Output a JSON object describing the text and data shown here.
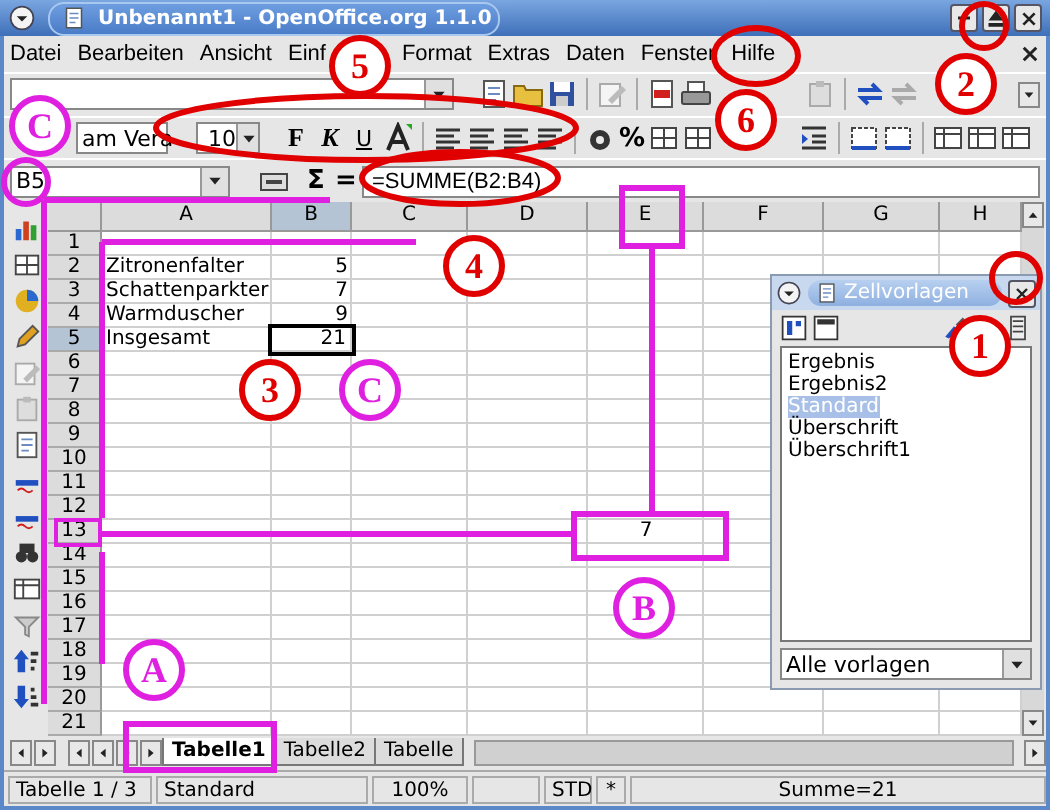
{
  "window": {
    "title": "Unbenannt1 - OpenOffice.org 1.1.0"
  },
  "menu": [
    "Datei",
    "Bearbeiten",
    "Ansicht",
    "Einf",
    "Format",
    "Extras",
    "Daten",
    "Fenster",
    "Hilfe"
  ],
  "format_toolbar": {
    "font_name": "am Vera",
    "font_size": "10",
    "style_buttons": [
      "F",
      "K",
      "U"
    ],
    "percent": "%"
  },
  "formula_bar": {
    "cell_ref": "B5",
    "sum_symbol": "Σ",
    "equals_symbol": "=",
    "formula": "=SUMME(B2:B4)"
  },
  "sheet": {
    "columns": [
      {
        "label": "A",
        "selected": false
      },
      {
        "label": "B",
        "selected": true
      },
      {
        "label": "C",
        "selected": false
      },
      {
        "label": "D",
        "selected": false
      },
      {
        "label": "E",
        "selected": false
      },
      {
        "label": "F",
        "selected": false
      },
      {
        "label": "G",
        "selected": false
      },
      {
        "label": "H",
        "selected": false
      }
    ],
    "rows": [
      {
        "label": "1",
        "selected": false
      },
      {
        "label": "2",
        "selected": false,
        "cells": [
          {
            "kind": "text",
            "value": "Zitronenfalter",
            "selected": false
          },
          {
            "kind": "number",
            "value": "5",
            "selected": false
          }
        ]
      },
      {
        "label": "3",
        "selected": false,
        "cells": [
          {
            "kind": "text",
            "value": "Schattenparkter",
            "selected": false
          },
          {
            "kind": "number",
            "value": "7",
            "selected": false
          }
        ]
      },
      {
        "label": "4",
        "selected": false,
        "cells": [
          {
            "kind": "text",
            "value": "Warmduscher",
            "selected": false
          },
          {
            "kind": "number",
            "value": "9",
            "selected": false
          }
        ]
      },
      {
        "label": "5",
        "selected": true,
        "cells": [
          {
            "kind": "text",
            "value": "Insgesamt",
            "selected": false
          },
          {
            "kind": "number",
            "value": "21",
            "selected": true
          }
        ]
      },
      {
        "label": "6",
        "selected": false
      },
      {
        "label": "7",
        "selected": false
      },
      {
        "label": "8",
        "selected": false
      },
      {
        "label": "9",
        "selected": false
      },
      {
        "label": "10",
        "selected": false
      },
      {
        "label": "11",
        "selected": false
      },
      {
        "label": "12",
        "selected": false
      },
      {
        "label": "13",
        "selected": false,
        "cells": [
          {
            "kind": "empty"
          },
          {
            "kind": "empty"
          },
          {
            "kind": "empty"
          },
          {
            "kind": "empty"
          },
          {
            "kind": "centered",
            "value": "7",
            "selected": false
          }
        ]
      },
      {
        "label": "14",
        "selected": false
      },
      {
        "label": "15",
        "selected": false
      },
      {
        "label": "16",
        "selected": false
      },
      {
        "label": "17",
        "selected": false
      },
      {
        "label": "18",
        "selected": false
      },
      {
        "label": "19",
        "selected": false
      },
      {
        "label": "20",
        "selected": false
      },
      {
        "label": "21",
        "selected": false
      }
    ]
  },
  "sheet_tabs": [
    {
      "label": "Tabelle1",
      "selected": true
    },
    {
      "label": "Tabelle2",
      "selected": false
    },
    {
      "label": "Tabelle",
      "selected": false
    }
  ],
  "styles_panel": {
    "title": "Zellvorlagen",
    "styles": [
      {
        "label": "Ergebnis",
        "selected": false
      },
      {
        "label": "Ergebnis2",
        "selected": false
      },
      {
        "label": "Standard",
        "selected": true
      },
      {
        "label": "Überschrift",
        "selected": false
      },
      {
        "label": "Überschrift1",
        "selected": false
      }
    ],
    "filter": "Alle vorlagen"
  },
  "status_bar": {
    "sheet": "Tabelle 1 / 3",
    "style": "Standard",
    "zoom": "100%",
    "mode": "STD",
    "modified": "*",
    "sum": "Summe=21"
  },
  "annotations": [
    {
      "label": "1",
      "color": "#e00000"
    },
    {
      "label": "2",
      "color": "#e00000"
    },
    {
      "label": "3",
      "color": "#e00000"
    },
    {
      "label": "4",
      "color": "#e00000"
    },
    {
      "label": "5",
      "color": "#e00000"
    },
    {
      "label": "6",
      "color": "#e00000"
    },
    {
      "label": "C",
      "color": "#e020e0"
    },
    {
      "label": "C",
      "color": "#e020e0"
    },
    {
      "label": "A",
      "color": "#e020e0"
    },
    {
      "label": "B",
      "color": "#e020e0"
    }
  ]
}
